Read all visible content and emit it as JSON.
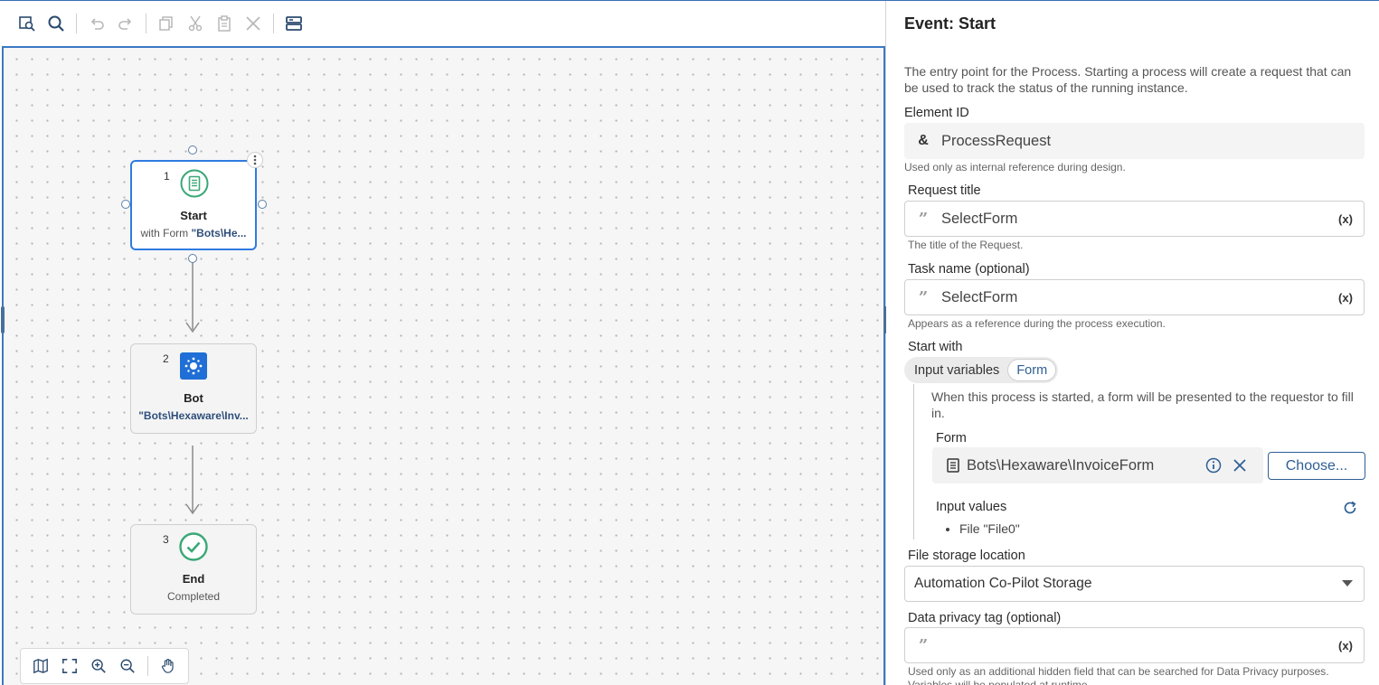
{
  "toolbar": {
    "icons": [
      "find-element-icon",
      "search-icon",
      "undo-icon",
      "redo-icon",
      "copy-icon",
      "cut-icon",
      "paste-icon",
      "delete-icon",
      "layout-icon"
    ]
  },
  "nodes": [
    {
      "number": "1",
      "title": "Start",
      "subtitle_prefix": "with Form ",
      "subtitle_emph": "\"Bots\\He...",
      "icon": "form-icon",
      "selected": true
    },
    {
      "number": "2",
      "title": "Bot",
      "subtitle_prefix": "",
      "subtitle_emph": "\"Bots\\Hexaware\\Inv...",
      "icon": "bot-icon",
      "selected": false
    },
    {
      "number": "3",
      "title": "End",
      "subtitle_prefix": "Completed",
      "subtitle_emph": "",
      "icon": "check-icon",
      "selected": false
    }
  ],
  "canvas_tools": [
    "map-icon",
    "fit-screen-icon",
    "zoom-in-icon",
    "zoom-out-icon",
    "hand-icon"
  ],
  "panel": {
    "title": "Event: Start",
    "description": "The entry point for the Process. Starting a process will create a request that can be used to track the status of the running instance.",
    "element_id": {
      "label": "Element ID",
      "value": "ProcessRequest",
      "help": "Used only as internal reference during design."
    },
    "request_title": {
      "label": "Request title",
      "value": "SelectForm",
      "suffix": "(x)",
      "help": "The title of the Request."
    },
    "task_name": {
      "label": "Task name (optional)",
      "value": "SelectForm",
      "suffix": "(x)",
      "help": "Appears as a reference during the process execution."
    },
    "start_with": {
      "label": "Start with",
      "options": [
        "Input variables",
        "Form"
      ],
      "selected": "Form",
      "description": "When this process is started, a form will be presented to the requestor to fill in.",
      "form_label": "Form",
      "form_value": "Bots\\Hexaware\\InvoiceForm",
      "choose_label": "Choose...",
      "input_values_label": "Input values",
      "input_values": [
        "File \"File0\""
      ]
    },
    "file_storage": {
      "label": "File storage location",
      "value": "Automation Co-Pilot Storage"
    },
    "privacy_tag": {
      "label": "Data privacy tag (optional)",
      "value": "",
      "suffix": "(x)",
      "help": "Used only as an additional hidden field that can be searched for Data Privacy purposes. Variables will be populated at runtime."
    }
  },
  "colors": {
    "accent": "#2e5f95",
    "selection": "#2f7be0",
    "start_green": "#3aa876",
    "bot_blue": "#1f6fd6"
  }
}
